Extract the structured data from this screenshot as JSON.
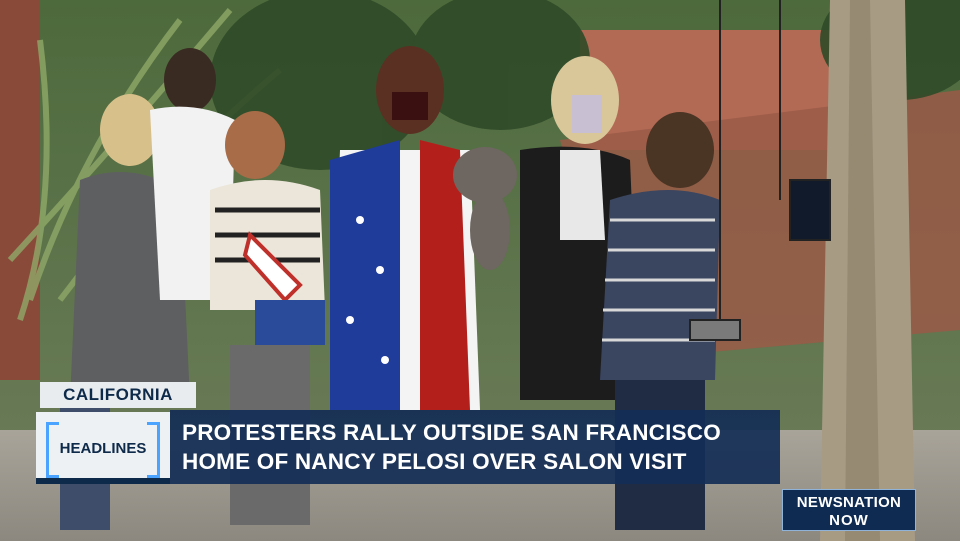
{
  "lower_third": {
    "region_tag": "CALIFORNIA",
    "section_tag": "HEADLINES",
    "headline": {
      "line1": "PROTESTERS RALLY OUTSIDE SAN FRANCISCO",
      "line2": "HOME OF NANCY PELOSI OVER SALON VISIT"
    }
  },
  "logo": {
    "line1": "NEWSNATION",
    "line2": "NOW"
  },
  "colors": {
    "navy": "#142e56",
    "light_panel": "#e9ecef",
    "bracket_blue": "#4aa3ff"
  }
}
